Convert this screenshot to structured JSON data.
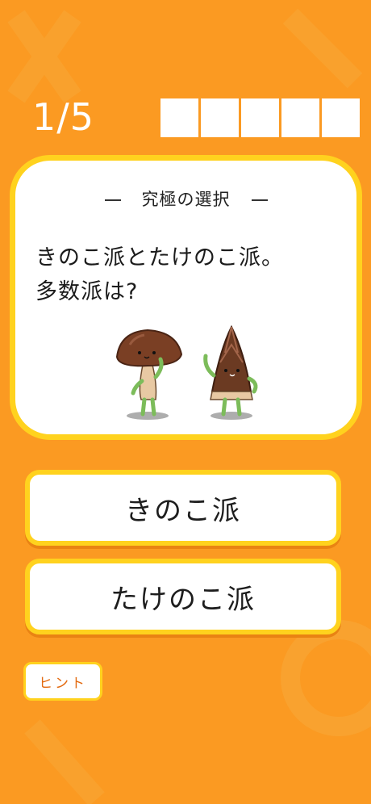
{
  "progress": {
    "count_text": "1/5",
    "current": 1,
    "total": 5
  },
  "question": {
    "header": "究極の選択",
    "text_line1": "きのこ派とたけのこ派。",
    "text_line2": "多数派は?",
    "illustration": [
      "mushroom-character-icon",
      "bamboo-shoot-character-icon"
    ]
  },
  "answers": [
    {
      "label": "きのこ派"
    },
    {
      "label": "たけのこ派"
    }
  ],
  "hint": {
    "label": "ヒント"
  },
  "colors": {
    "background": "#fb9a22",
    "accent": "#ffd21e",
    "hint_text": "#e36a10"
  }
}
